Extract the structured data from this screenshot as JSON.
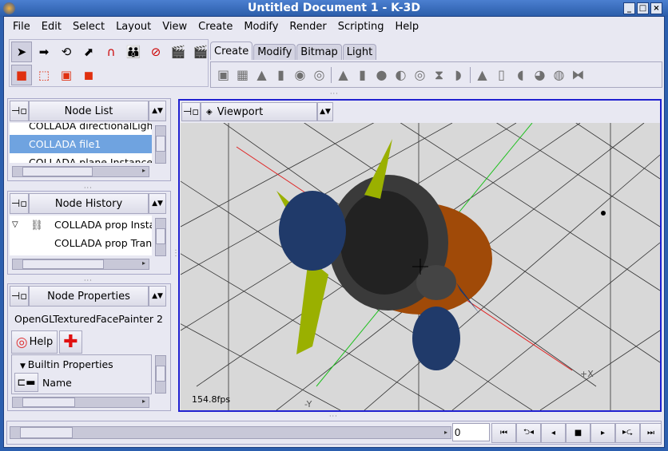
{
  "window": {
    "title": "Untitled Document 1 - K-3D"
  },
  "menu": [
    "File",
    "Edit",
    "Select",
    "Layout",
    "View",
    "Create",
    "Modify",
    "Render",
    "Scripting",
    "Help"
  ],
  "toolbar": {
    "tools": [
      "select-tool",
      "move-tool",
      "rotate-tool",
      "scale-tool",
      "snap-tool",
      "parent-tool",
      "unparent-tool",
      "render-frame",
      "render-animation"
    ],
    "selection_modes": [
      "node-mode",
      "point-mode",
      "edge-mode",
      "face-mode"
    ],
    "tabs": [
      "Create",
      "Modify",
      "Bitmap",
      "Light"
    ],
    "active_tab": "Create",
    "create_items": [
      "poly-cube",
      "poly-grid",
      "poly-cone",
      "poly-cylinder",
      "poly-sphere",
      "poly-torus",
      "cone",
      "cylinder",
      "disk",
      "sphere",
      "torus",
      "hyperboloid",
      "paraboloid",
      "nurbs-cone",
      "nurbs-cylinder",
      "nurbs-disk",
      "nurbs-sphere",
      "nurbs-torus",
      "nurbs-hyperboloid"
    ]
  },
  "node_list": {
    "title": "Node List",
    "items": [
      "COLLADA directionalLight",
      "COLLADA file1",
      "COLLADA plane Instance"
    ],
    "selected": 1
  },
  "node_history": {
    "title": "Node History",
    "items": [
      "COLLADA prop Insta",
      "COLLADA prop Trans"
    ]
  },
  "node_properties": {
    "title": "Node Properties",
    "node_name": "OpenGLTexturedFacePainter 2",
    "help_label": "Help",
    "section": "Builtin Properties",
    "property": "Name"
  },
  "viewport": {
    "title": "Viewport",
    "fps": "154.8fps",
    "axis_x": "+X",
    "axis_y": "-Y"
  },
  "timeline": {
    "frame": "0",
    "buttons": [
      "start",
      "play-reverse-loop",
      "play-reverse",
      "stop",
      "play",
      "play-loop",
      "end"
    ]
  },
  "colors": {
    "accent": "#2020d0",
    "selection": "#6fa3e0",
    "title": "#2a5ca8"
  }
}
